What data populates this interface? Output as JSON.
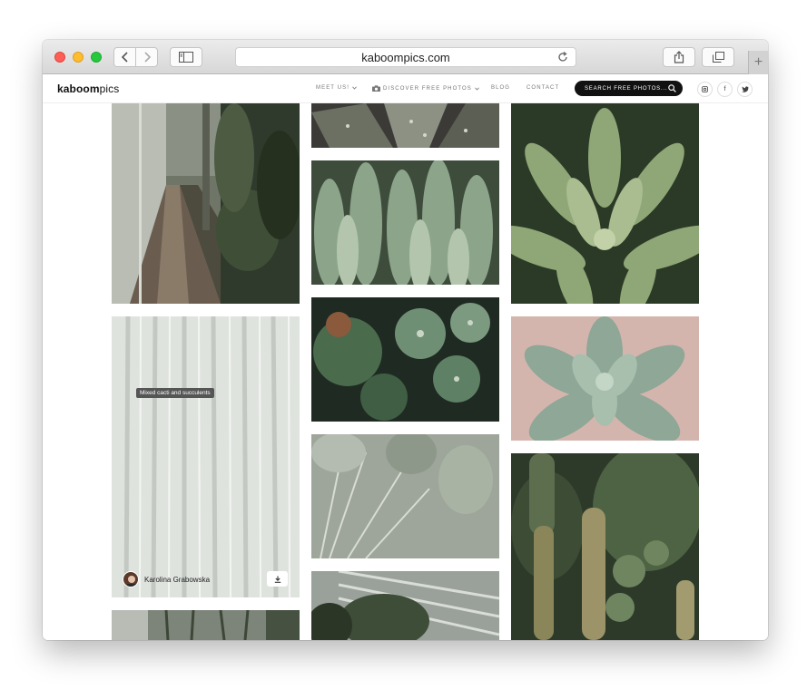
{
  "browser": {
    "url": "kaboompics.com",
    "new_tab_label": "+"
  },
  "site": {
    "logo_bold": "kaboom",
    "logo_light": "pics",
    "nav": {
      "meet_us": "MEET US!",
      "discover": "DISCOVER FREE PHOTOS",
      "blog": "BLOG",
      "contact": "CONTACT"
    },
    "search_placeholder": "SEARCH FREE PHOTOS...",
    "social": {
      "facebook": "f"
    }
  },
  "gallery": {
    "tooltip": "Mixed cacti and succulents",
    "author_name": "Karolina Grabowska"
  },
  "icons": {
    "back": "chevron-left-icon",
    "forward": "chevron-right-icon",
    "sidebar": "sidebar-icon",
    "reload": "reload-icon",
    "share": "share-icon",
    "tabs": "tabs-icon",
    "camera": "camera-icon",
    "search": "search-icon",
    "instagram": "instagram-icon",
    "twitter": "twitter-icon",
    "download": "download-icon"
  },
  "colors": {
    "search_pill": "#111111",
    "close": "#fd5f57",
    "minimize": "#febc2e",
    "maximize": "#27c840"
  }
}
